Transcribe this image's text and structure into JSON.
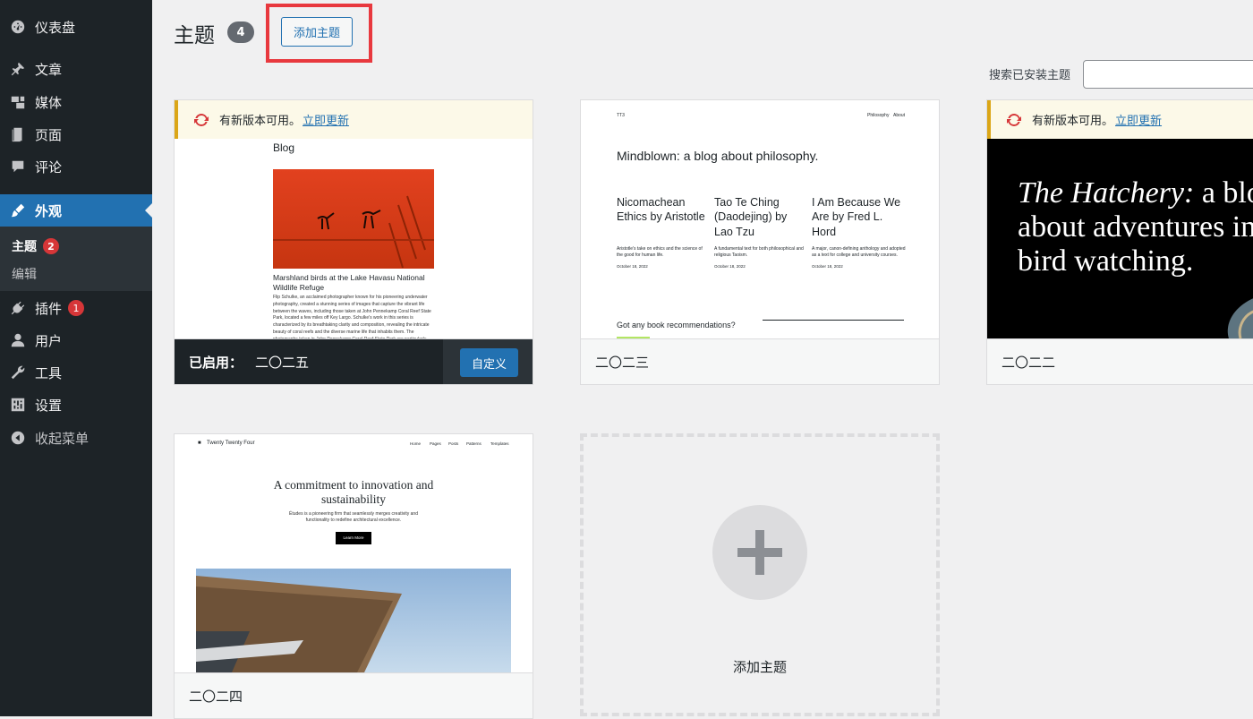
{
  "sidebar": {
    "items": [
      {
        "label": "仪表盘",
        "icon": "dashboard-icon"
      },
      {
        "label": "文章",
        "icon": "pin-icon"
      },
      {
        "label": "媒体",
        "icon": "media-icon"
      },
      {
        "label": "页面",
        "icon": "page-icon"
      },
      {
        "label": "评论",
        "icon": "comment-icon"
      },
      {
        "label": "外观",
        "icon": "brush-icon"
      },
      {
        "label": "插件",
        "icon": "plugin-icon",
        "badge": "1"
      },
      {
        "label": "用户",
        "icon": "user-icon"
      },
      {
        "label": "工具",
        "icon": "wrench-icon"
      },
      {
        "label": "设置",
        "icon": "settings-icon"
      },
      {
        "label": "收起菜单",
        "icon": "collapse-icon"
      }
    ],
    "submenu": [
      {
        "label": "主题",
        "badge": "2"
      },
      {
        "label": "编辑"
      }
    ]
  },
  "header": {
    "title": "主题",
    "count": "4",
    "add_button": "添加主题",
    "search_label": "搜索已安装主题",
    "search_value": ""
  },
  "themes": [
    {
      "name": "二〇二五",
      "active_prefix": "已启用：",
      "customize_label": "自定义",
      "notice": "有新版本可用。",
      "notice_link": "立即更新",
      "preview": {
        "heading": "Blog",
        "caption": "Marshland birds at the Lake Havasu National Wildlife Refuge",
        "body": "Flip Schulke, an acclaimed photographer known for his pioneering underwater photography, created a stunning series of images that capture the vibrant life between the waves, including those taken at John Pennekamp Coral Reef State Park, located a few miles off Key Largo. Schulke's work in this series is characterized by its breathtaking clarity and composition, revealing the intricate beauty of coral reefs and the diverse marine life that inhabits them. The photographs taken in John Pennekamp Coral Reef State Park are particularly notable for their vivid depiction of the underwater ecosystem."
      }
    },
    {
      "name": "二〇二三",
      "preview": {
        "site": "TT3",
        "nav": [
          "Philosophy",
          "About"
        ],
        "headline": "Mindblown: a blog about philosophy.",
        "posts": [
          {
            "title": "Nicomachean Ethics by Aristotle",
            "excerpt": "Aristotle's take on ethics and the science of the good for human life.",
            "date": "October 18, 2022"
          },
          {
            "title": "Tao Te Ching (Daodejing) by Lao Tzu",
            "excerpt": "A fundamental text for both philosophical and religious Taoism.",
            "date": "October 18, 2022"
          },
          {
            "title": "I Am Because We Are by Fred L. Hord",
            "excerpt": "A major, canon-defining anthology and adopted as a text for college and university courses.",
            "date": "October 18, 2022"
          }
        ],
        "footer_text": "Got any book recommendations?"
      }
    },
    {
      "name": "二〇二二",
      "notice": "有新版本可用。",
      "notice_link": "立即更新",
      "preview": {
        "headline_italic": "The Hatchery:",
        "headline_rest": " a blog about adventures in bird watching."
      }
    },
    {
      "name": "二〇二四",
      "preview": {
        "site": "Twenty Twenty Four",
        "nav": [
          "Home",
          "Pages",
          "Posts",
          "Patterns",
          "Templates"
        ],
        "headline": "A commitment to innovation and sustainability",
        "sub": "Études is a pioneering firm that seamlessly merges creativity and functionality to redefine architectural excellence.",
        "cta": "Learn More"
      }
    }
  ],
  "add_tile": {
    "label": "添加主题"
  },
  "colors": {
    "sidebar_bg": "#1d2327",
    "accent": "#2271b1",
    "badge": "#d63638",
    "highlight": "#e8383e",
    "notice_border": "#dba617"
  }
}
